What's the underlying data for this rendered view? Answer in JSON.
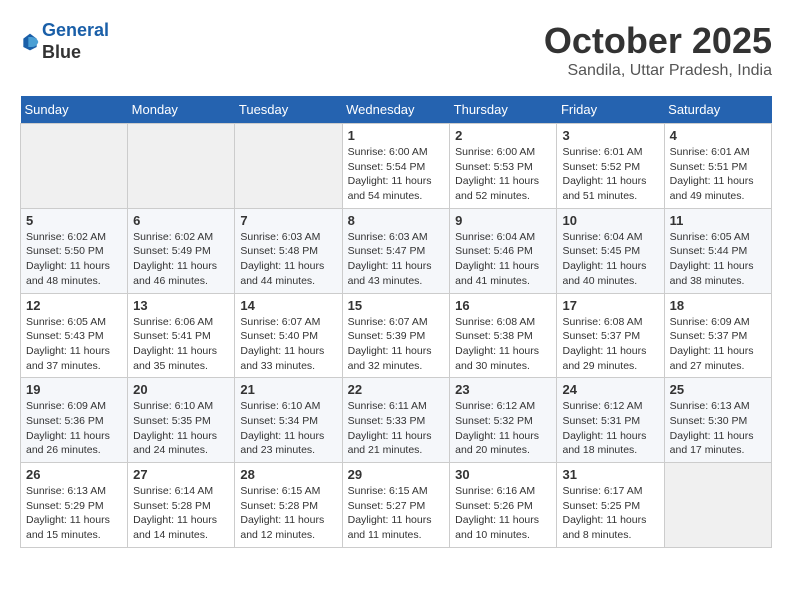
{
  "header": {
    "logo_line1": "General",
    "logo_line2": "Blue",
    "month": "October 2025",
    "location": "Sandila, Uttar Pradesh, India"
  },
  "weekdays": [
    "Sunday",
    "Monday",
    "Tuesday",
    "Wednesday",
    "Thursday",
    "Friday",
    "Saturday"
  ],
  "weeks": [
    [
      {
        "day": "",
        "info": ""
      },
      {
        "day": "",
        "info": ""
      },
      {
        "day": "",
        "info": ""
      },
      {
        "day": "1",
        "info": "Sunrise: 6:00 AM\nSunset: 5:54 PM\nDaylight: 11 hours\nand 54 minutes."
      },
      {
        "day": "2",
        "info": "Sunrise: 6:00 AM\nSunset: 5:53 PM\nDaylight: 11 hours\nand 52 minutes."
      },
      {
        "day": "3",
        "info": "Sunrise: 6:01 AM\nSunset: 5:52 PM\nDaylight: 11 hours\nand 51 minutes."
      },
      {
        "day": "4",
        "info": "Sunrise: 6:01 AM\nSunset: 5:51 PM\nDaylight: 11 hours\nand 49 minutes."
      }
    ],
    [
      {
        "day": "5",
        "info": "Sunrise: 6:02 AM\nSunset: 5:50 PM\nDaylight: 11 hours\nand 48 minutes."
      },
      {
        "day": "6",
        "info": "Sunrise: 6:02 AM\nSunset: 5:49 PM\nDaylight: 11 hours\nand 46 minutes."
      },
      {
        "day": "7",
        "info": "Sunrise: 6:03 AM\nSunset: 5:48 PM\nDaylight: 11 hours\nand 44 minutes."
      },
      {
        "day": "8",
        "info": "Sunrise: 6:03 AM\nSunset: 5:47 PM\nDaylight: 11 hours\nand 43 minutes."
      },
      {
        "day": "9",
        "info": "Sunrise: 6:04 AM\nSunset: 5:46 PM\nDaylight: 11 hours\nand 41 minutes."
      },
      {
        "day": "10",
        "info": "Sunrise: 6:04 AM\nSunset: 5:45 PM\nDaylight: 11 hours\nand 40 minutes."
      },
      {
        "day": "11",
        "info": "Sunrise: 6:05 AM\nSunset: 5:44 PM\nDaylight: 11 hours\nand 38 minutes."
      }
    ],
    [
      {
        "day": "12",
        "info": "Sunrise: 6:05 AM\nSunset: 5:43 PM\nDaylight: 11 hours\nand 37 minutes."
      },
      {
        "day": "13",
        "info": "Sunrise: 6:06 AM\nSunset: 5:41 PM\nDaylight: 11 hours\nand 35 minutes."
      },
      {
        "day": "14",
        "info": "Sunrise: 6:07 AM\nSunset: 5:40 PM\nDaylight: 11 hours\nand 33 minutes."
      },
      {
        "day": "15",
        "info": "Sunrise: 6:07 AM\nSunset: 5:39 PM\nDaylight: 11 hours\nand 32 minutes."
      },
      {
        "day": "16",
        "info": "Sunrise: 6:08 AM\nSunset: 5:38 PM\nDaylight: 11 hours\nand 30 minutes."
      },
      {
        "day": "17",
        "info": "Sunrise: 6:08 AM\nSunset: 5:37 PM\nDaylight: 11 hours\nand 29 minutes."
      },
      {
        "day": "18",
        "info": "Sunrise: 6:09 AM\nSunset: 5:37 PM\nDaylight: 11 hours\nand 27 minutes."
      }
    ],
    [
      {
        "day": "19",
        "info": "Sunrise: 6:09 AM\nSunset: 5:36 PM\nDaylight: 11 hours\nand 26 minutes."
      },
      {
        "day": "20",
        "info": "Sunrise: 6:10 AM\nSunset: 5:35 PM\nDaylight: 11 hours\nand 24 minutes."
      },
      {
        "day": "21",
        "info": "Sunrise: 6:10 AM\nSunset: 5:34 PM\nDaylight: 11 hours\nand 23 minutes."
      },
      {
        "day": "22",
        "info": "Sunrise: 6:11 AM\nSunset: 5:33 PM\nDaylight: 11 hours\nand 21 minutes."
      },
      {
        "day": "23",
        "info": "Sunrise: 6:12 AM\nSunset: 5:32 PM\nDaylight: 11 hours\nand 20 minutes."
      },
      {
        "day": "24",
        "info": "Sunrise: 6:12 AM\nSunset: 5:31 PM\nDaylight: 11 hours\nand 18 minutes."
      },
      {
        "day": "25",
        "info": "Sunrise: 6:13 AM\nSunset: 5:30 PM\nDaylight: 11 hours\nand 17 minutes."
      }
    ],
    [
      {
        "day": "26",
        "info": "Sunrise: 6:13 AM\nSunset: 5:29 PM\nDaylight: 11 hours\nand 15 minutes."
      },
      {
        "day": "27",
        "info": "Sunrise: 6:14 AM\nSunset: 5:28 PM\nDaylight: 11 hours\nand 14 minutes."
      },
      {
        "day": "28",
        "info": "Sunrise: 6:15 AM\nSunset: 5:28 PM\nDaylight: 11 hours\nand 12 minutes."
      },
      {
        "day": "29",
        "info": "Sunrise: 6:15 AM\nSunset: 5:27 PM\nDaylight: 11 hours\nand 11 minutes."
      },
      {
        "day": "30",
        "info": "Sunrise: 6:16 AM\nSunset: 5:26 PM\nDaylight: 11 hours\nand 10 minutes."
      },
      {
        "day": "31",
        "info": "Sunrise: 6:17 AM\nSunset: 5:25 PM\nDaylight: 11 hours\nand 8 minutes."
      },
      {
        "day": "",
        "info": ""
      }
    ]
  ]
}
